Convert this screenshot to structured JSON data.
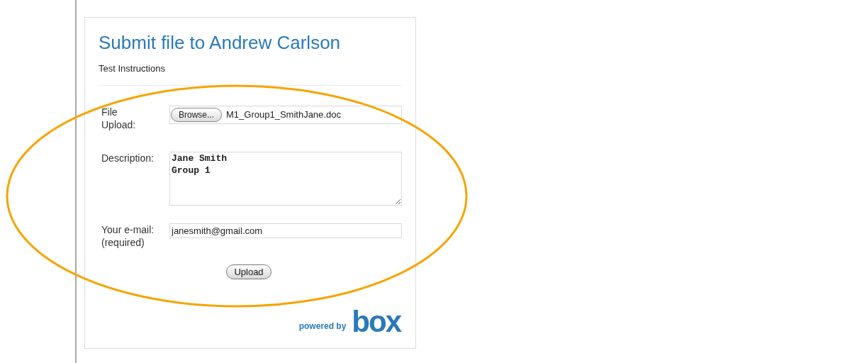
{
  "form": {
    "title": "Submit file to Andrew Carlson",
    "instructions": "Test Instructions",
    "fields": [
      {
        "kind": "file",
        "label": "File\nUpload:",
        "button": "Browse...",
        "value": "M1_Group1_SmithJane.doc"
      },
      {
        "kind": "textarea",
        "label": "Description:",
        "value": "Jane Smith\nGroup 1"
      },
      {
        "kind": "text",
        "label": "Your e-mail:\n(required)",
        "value": "janesmith@gmail.com"
      }
    ],
    "submit": "Upload",
    "footer": {
      "powered_by": "powered by",
      "logo": "box"
    }
  }
}
